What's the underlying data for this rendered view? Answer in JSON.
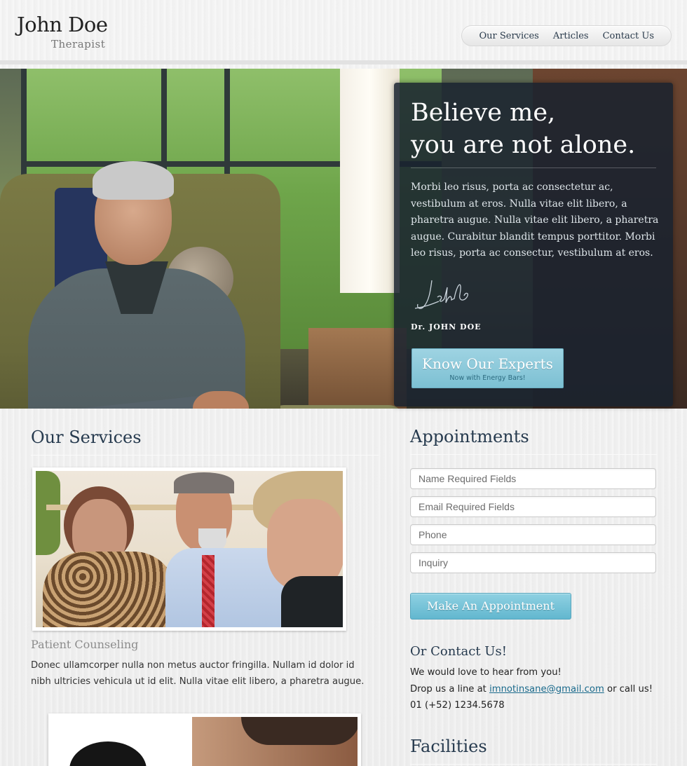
{
  "header": {
    "logo_name": "John Doe",
    "logo_subtitle": "Therapist",
    "nav": [
      "Our Services",
      "Articles",
      "Contact Us"
    ]
  },
  "hero": {
    "title_line1": "Believe me,",
    "title_line2": "you are not alone.",
    "body": "Morbi leo risus, porta ac consectetur ac, vestibulum at eros. Nulla vitae elit libero, a pharetra augue. Nulla vitae elit libero, a pharetra augue. Curabitur blandit tempus porttitor.  Morbi leo risus, porta ac consectur, vestibulum at eros.",
    "signature_name": "Dr. JOHN DOE",
    "button_label": "Know Our Experts",
    "button_sublabel": "Now with Energy Bars!"
  },
  "services": {
    "title": "Our Services",
    "caption": "Patient Counseling",
    "paragraph": "Donec ullamcorper nulla non metus auctor fringilla. Nullam id dolor id nibh ultricies vehicula ut id elit. Nulla vitae elit libero, a pharetra augue."
  },
  "appointments": {
    "title": "Appointments",
    "fields": {
      "name_placeholder": "Name Required Fields",
      "email_placeholder": "Email Required Fields",
      "phone_placeholder": "Phone",
      "inquiry_placeholder": "Inquiry"
    },
    "button_label": "Make An Appointment"
  },
  "contact": {
    "title": "Or Contact Us!",
    "line1": "We would love to hear from you!",
    "line2_prefix": "Drop us a line at",
    "email": "imnotinsane@gmail.com",
    "line2_suffix": "or call us!",
    "phone": "01 (+52) 1234.5678"
  },
  "facilities": {
    "title": "Facilities"
  },
  "colors": {
    "accent": "#7cc0d3",
    "heading": "#263a4e",
    "hero_box": "#18222e"
  }
}
